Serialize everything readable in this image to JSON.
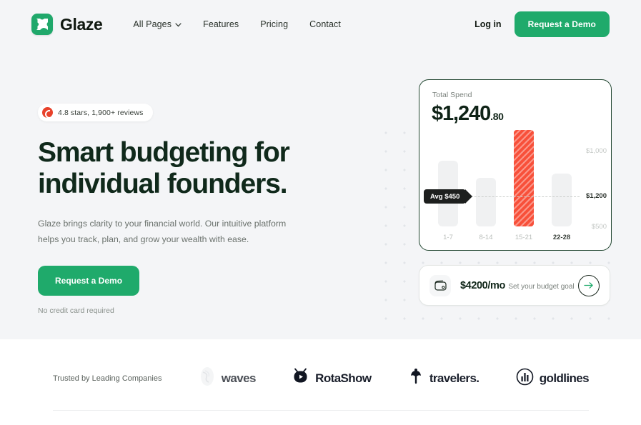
{
  "nav": {
    "brand": "Glaze",
    "logo_icon": "glaze-x-mark",
    "links": [
      {
        "label": "All Pages",
        "has_chevron": true
      },
      {
        "label": "Features",
        "has_chevron": false
      },
      {
        "label": "Pricing",
        "has_chevron": false
      },
      {
        "label": "Contact",
        "has_chevron": false
      }
    ],
    "login": "Log in",
    "demo_button": "Request a Demo"
  },
  "hero": {
    "rating_badge": "4.8 stars, 1,900+ reviews",
    "rating_icon": "capterra-circle-icon",
    "headline_line1": "Smart budgeting for",
    "headline_line2": "individual founders.",
    "subtext_line1": "Glaze brings clarity to your financial world. Our intuitive platform helps",
    "subtext_line2": "you track, plan, and grow your wealth with ease.",
    "cta": "Request a Demo",
    "note": "No credit card required"
  },
  "chart_card": {
    "label": "Total Spend",
    "amount_main": "$1,240",
    "amount_cents": ".80",
    "tooltip": "Avg $450"
  },
  "chart_data": {
    "type": "bar",
    "title": "Total Spend",
    "categories": [
      "1-7",
      "8-14",
      "15-21",
      "22-28"
    ],
    "values": [
      700,
      520,
      1020,
      560
    ],
    "highlight_index": 2,
    "ytick_labels": [
      "$1,000",
      "$1,200",
      "$500"
    ],
    "ytick_positions": [
      0.12,
      0.5,
      0.78
    ],
    "annotation": {
      "label": "Avg $450",
      "line": "dashed",
      "at": 0.5
    },
    "xlabel": "",
    "ylabel": "",
    "grid": false,
    "legend": "none",
    "colors": {
      "bar": "#f0f1f2",
      "highlight": "#f8503a"
    }
  },
  "goal_card": {
    "icon": "wallet-icon",
    "amount": "$4200/mo",
    "subtitle": "Set your budget goal",
    "arrow_icon": "arrow-right-icon"
  },
  "logos": {
    "trusted_text": "Trusted by  Leading Companies",
    "items": [
      {
        "name": "waves",
        "icon": "waves-swirl-icon"
      },
      {
        "name": "RotaShow",
        "icon": "rotashow-tv-icon"
      },
      {
        "name": "travelers.",
        "icon": "travelers-umbrella-icon"
      },
      {
        "name": "goldlines",
        "icon": "goldlines-circle-icon",
        "light_tail": "es"
      }
    ]
  },
  "colors": {
    "brand_green": "#1faa6b",
    "accent_red": "#f8503a",
    "page_bg": "#f4f5f7",
    "ink": "#10291b"
  }
}
